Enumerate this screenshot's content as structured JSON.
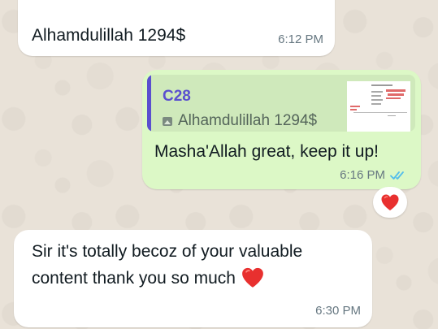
{
  "messages": [
    {
      "direction": "incoming",
      "text": "Alhamdulillah 1294$",
      "time": "6:12 PM"
    },
    {
      "direction": "outgoing",
      "reply_to": {
        "author": "C28",
        "text": "Alhamdulillah 1294$",
        "media_icon": "photo-icon"
      },
      "text": "Masha'Allah great, keep it up!",
      "time": "6:16 PM",
      "status": "read",
      "status_icon": "double-check-icon",
      "reaction": "heart-emoji"
    },
    {
      "direction": "incoming",
      "text": "Sir it's totally becoz of your valuable content thank you so much",
      "emoji": "heart-emoji",
      "time": "6:30 PM"
    }
  ],
  "colors": {
    "incoming_bubble": "#ffffff",
    "outgoing_bubble": "#dcf8c6",
    "quote_accent": "#5a4fcf",
    "read_ticks": "#53bdeb",
    "heart": "#e8302f"
  }
}
